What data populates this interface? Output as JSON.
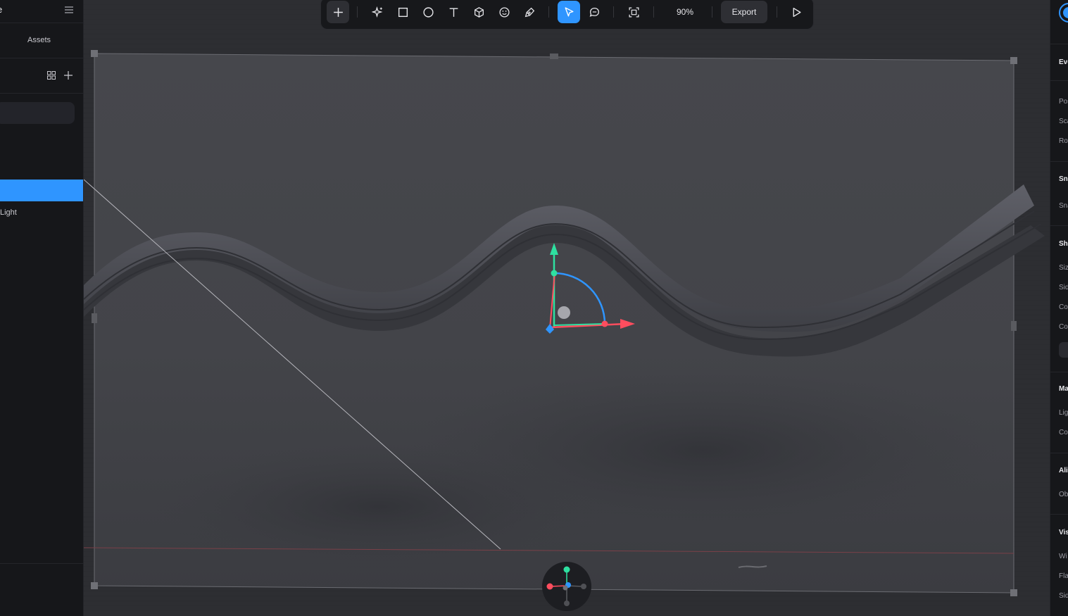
{
  "left_panel": {
    "title": "e",
    "tabs": {
      "assets": "Assets"
    },
    "layer_items": {
      "light": "Light"
    }
  },
  "toolbar": {
    "zoom": "90%",
    "export_label": "Export",
    "icons": [
      "plus-icon",
      "sparkle-icon",
      "rectangle-icon",
      "ellipse-icon",
      "text-icon",
      "cube-icon",
      "emoji-icon",
      "pen-icon",
      "cursor-icon",
      "comment-icon",
      "frame-icon",
      "play-icon"
    ]
  },
  "right_panel": {
    "sections": {
      "events": "Eve",
      "snapping": "Sna",
      "shape": "Sha",
      "material": "Ma",
      "align": "Ali",
      "visibility": "Vis"
    },
    "labels": {
      "position": "Pos",
      "scale": "Sca",
      "rotation": "Rot",
      "snap": "Sna",
      "size": "Siz",
      "sides": "Sid",
      "corner1": "Co",
      "corner2": "Co",
      "lighting": "Lig",
      "color": "Co",
      "object": "Ob",
      "wireframe": "Wi",
      "flat": "Fla",
      "side": "Sid"
    }
  },
  "colors": {
    "accent": "#2f95ff",
    "axis_x": "#ff4d5e",
    "axis_y": "#2ee0a0",
    "axis_z": "#2f95ff"
  }
}
